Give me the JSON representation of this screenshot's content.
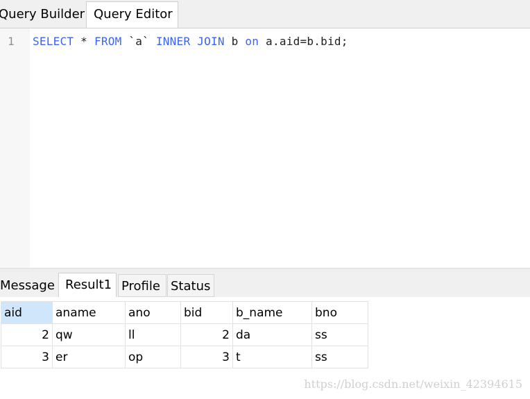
{
  "tabs": {
    "query_builder": "Query Builder",
    "query_editor": "Query Editor"
  },
  "editor": {
    "line_number": "1",
    "code": {
      "t1": "SELECT",
      "t2": " * ",
      "t3": "FROM",
      "t4": " `a` ",
      "t5": "INNER",
      "t6": " ",
      "t7": "JOIN",
      "t8": " b ",
      "t9": "on",
      "t10": " a.aid=b.bid;"
    }
  },
  "result_tabs": {
    "message": "Message",
    "result1": "Result1",
    "profile": "Profile",
    "status": "Status"
  },
  "result": {
    "columns": [
      "aid",
      "aname",
      "ano",
      "bid",
      "b_name",
      "bno"
    ],
    "rows": [
      [
        "2",
        "qw",
        "ll",
        "2",
        "da",
        "ss"
      ],
      [
        "3",
        "er",
        "op",
        "3",
        "t",
        "ss"
      ]
    ]
  },
  "watermark": "https://blog.csdn.net/weixin_42394615",
  "colors": {
    "keyword": "#3b63f5",
    "selected_header": "#cfe6fb"
  }
}
